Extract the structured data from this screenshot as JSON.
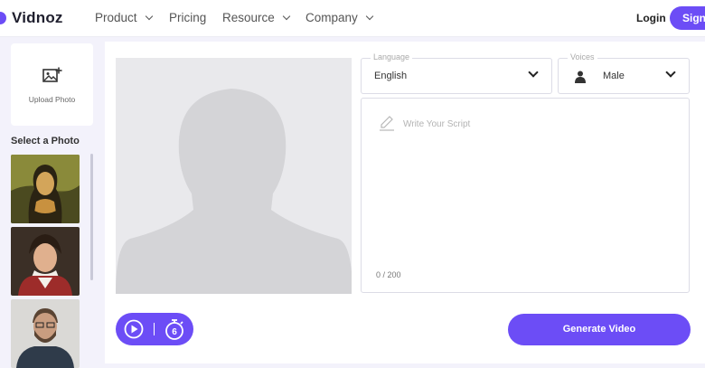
{
  "brand": {
    "name": "Vidnoz",
    "accent": "#6c4df6"
  },
  "nav": {
    "items": [
      {
        "label": "Product",
        "has_dropdown": true
      },
      {
        "label": "Pricing",
        "has_dropdown": false
      },
      {
        "label": "Resource",
        "has_dropdown": true
      },
      {
        "label": "Company",
        "has_dropdown": true
      }
    ],
    "login": "Login",
    "signup": "Sign"
  },
  "sidebar": {
    "upload_label": "Upload Photo",
    "upload_icon": "image-plus-icon",
    "select_title": "Select a Photo",
    "photos": [
      "mona-lisa",
      "napoleon",
      "bearded-man"
    ]
  },
  "editor": {
    "language": {
      "legend": "Language",
      "value": "English"
    },
    "voices": {
      "legend": "Voices",
      "value": "Male",
      "icon": "person-icon"
    },
    "script": {
      "placeholder": "Write Your Script",
      "count": "0 / 200",
      "icon": "pencil-icon"
    },
    "controls": {
      "play_icon": "play-icon",
      "timer_icon": "timer-icon",
      "timer_value": "6"
    },
    "generate_label": "Generate Video"
  }
}
